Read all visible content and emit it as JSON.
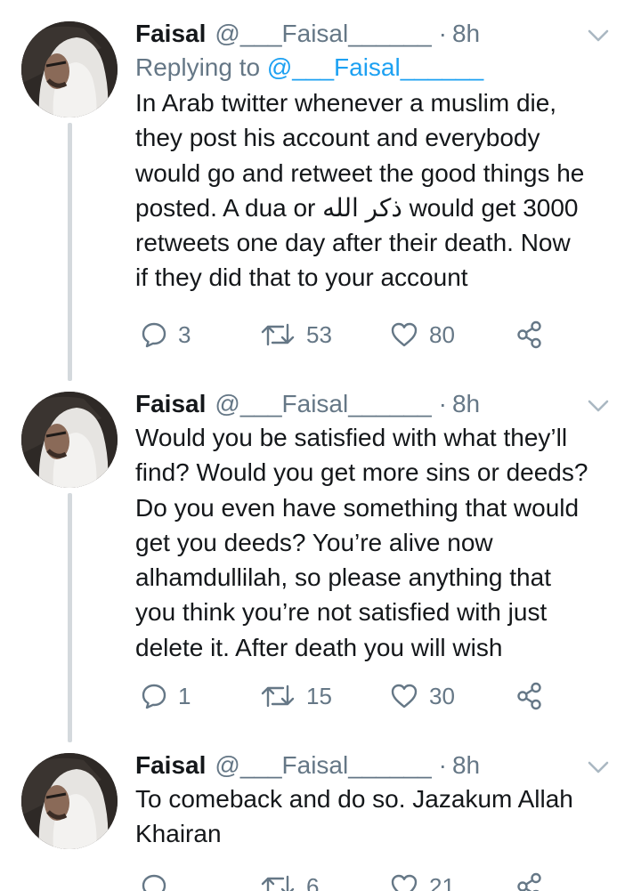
{
  "thread": {
    "tweets": [
      {
        "display_name": "Faisal",
        "handle": "@___Faisal______",
        "separator": "·",
        "time": "8h",
        "replying_label": "Replying to",
        "replying_handle": "@___Faisal______",
        "text": "In Arab twitter whenever a muslim die,\nthey post his account and everybody\nwould go and retweet the good things he\nposted. A dua or ذكر الله would get 3000\nretweets one day after their death. Now\nif they did that to your account",
        "replies": "3",
        "retweets": "53",
        "likes": "80"
      },
      {
        "display_name": "Faisal",
        "handle": "@___Faisal______",
        "separator": "·",
        "time": "8h",
        "text": "Would you be satisfied with what they’ll\nfind? Would you get more sins or deeds?\nDo you even have something that would\nget you deeds? You’re alive now\nalhamdullilah, so please anything that\nyou think you’re not satisfied with just\ndelete it. After death you will wish",
        "replies": "1",
        "retweets": "15",
        "likes": "30"
      },
      {
        "display_name": "Faisal",
        "handle": "@___Faisal______",
        "separator": "·",
        "time": "8h",
        "text": "To comeback and do so. Jazakum Allah\nKhairan",
        "replies": "",
        "retweets": "6",
        "likes": "21"
      }
    ]
  },
  "colors": {
    "text": "#14171a",
    "secondary": "#657786",
    "link": "#1da1f2",
    "thread_line": "#d4d9dd"
  },
  "icons": [
    "chevron-down-icon",
    "reply-icon",
    "retweet-icon",
    "like-icon",
    "share-icon"
  ]
}
